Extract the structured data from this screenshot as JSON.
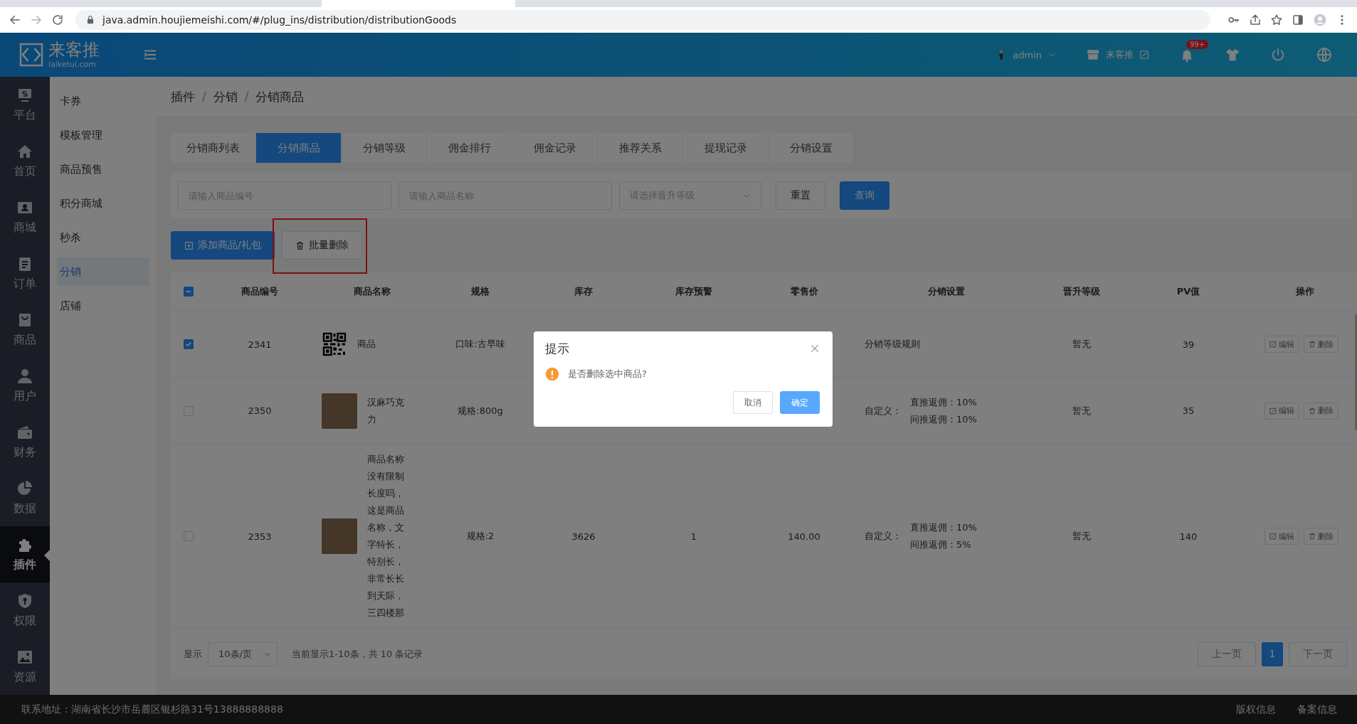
{
  "browser": {
    "url": "java.admin.houjiemeishi.com/#/plug_ins/distribution/distributionGoods"
  },
  "header": {
    "logo_text": "来客推",
    "logo_subtext": "laiketui.com",
    "user": "admin",
    "store": "来客推",
    "notification_badge": "99+"
  },
  "nav": [
    {
      "label": "平台",
      "selected": false
    },
    {
      "label": "首页",
      "selected": false
    },
    {
      "label": "商城",
      "selected": false
    },
    {
      "label": "订单",
      "selected": false
    },
    {
      "label": "商品",
      "selected": false
    },
    {
      "label": "用户",
      "selected": false
    },
    {
      "label": "财务",
      "selected": false
    },
    {
      "label": "数据",
      "selected": false
    },
    {
      "label": "插件",
      "selected": true
    },
    {
      "label": "权限",
      "selected": false
    },
    {
      "label": "资源",
      "selected": false
    }
  ],
  "submenu": [
    {
      "label": "卡券",
      "selected": false
    },
    {
      "label": "模板管理",
      "selected": false
    },
    {
      "label": "商品预售",
      "selected": false
    },
    {
      "label": "积分商城",
      "selected": false
    },
    {
      "label": "秒杀",
      "selected": false
    },
    {
      "label": "分销",
      "selected": true
    },
    {
      "label": "店铺",
      "selected": false
    }
  ],
  "breadcrumb": {
    "items": [
      "插件",
      "分销",
      "分销商品"
    ],
    "separator": "/"
  },
  "tabs": [
    {
      "label": "分销商列表",
      "selected": false
    },
    {
      "label": "分销商品",
      "selected": true
    },
    {
      "label": "分销等级",
      "selected": false
    },
    {
      "label": "佣金排行",
      "selected": false
    },
    {
      "label": "佣金记录",
      "selected": false
    },
    {
      "label": "推荐关系",
      "selected": false
    },
    {
      "label": "提现记录",
      "selected": false
    },
    {
      "label": "分销设置",
      "selected": false
    }
  ],
  "filters": {
    "code_placeholder": "请输入商品编号",
    "name_placeholder": "请输入商品名称",
    "level_placeholder": "请选择晋升等级",
    "reset": "重置",
    "search": "查询"
  },
  "actions": {
    "add": "添加商品/礼包",
    "batch_delete": "批量删除",
    "highlighted": true
  },
  "table": {
    "select_all": {
      "indeterminate": true
    },
    "columns": [
      "商品编号",
      "商品名称",
      "规格",
      "库存",
      "库存预警",
      "零售价",
      "分销设置",
      "晋升等级",
      "PV值",
      "操作"
    ],
    "rows": [
      {
        "checked": true,
        "id": "2341",
        "kind": "qr",
        "name": "商品",
        "spec": "口味:古早味",
        "distribution": {
          "kind": "rule",
          "text": "分销等级规则"
        },
        "level": "暂无",
        "pv": "39",
        "edit": "编辑",
        "delete": "删除"
      },
      {
        "checked": false,
        "id": "2350",
        "kind": "photo",
        "name": "汉麻巧克力",
        "spec": "规格:800g",
        "distribution": {
          "kind": "custom",
          "label": "自定义：",
          "lines": [
            "直推返佣：10%",
            "间推返佣：10%"
          ]
        },
        "level": "暂无",
        "pv": "35",
        "edit": "编辑",
        "delete": "删除"
      },
      {
        "checked": false,
        "id": "2353",
        "kind": "photo",
        "name": "商品名称没有限制长度吗，这是商品名称，文字特长，特别长，非常长长到天际，三四楼那",
        "spec": "规格:2",
        "stock": "3626",
        "warning": "1",
        "price": "140.00",
        "distribution": {
          "kind": "custom",
          "label": "自定义：",
          "lines": [
            "直推返佣：10%",
            "间推返佣：5%"
          ]
        },
        "level": "暂无",
        "pv": "140",
        "edit": "编辑",
        "delete": "删除"
      }
    ]
  },
  "pagination": {
    "label": "显示",
    "page_size": "10条/页",
    "summary": "当前显示1-10条，共 10 条记录",
    "prev": "上一页",
    "prev_disabled": true,
    "pages": [
      {
        "label": "1",
        "selected": true
      }
    ],
    "next": "下一页",
    "next_disabled": true
  },
  "footer": {
    "address": "联系地址：湖南省长沙市岳麓区银杉路31号13888888888",
    "links": [
      "版权信息",
      "备案信息"
    ]
  },
  "dialog": {
    "title": "提示",
    "message": "是否删除选中商品?",
    "cancel": "取消",
    "confirm": "确定"
  }
}
